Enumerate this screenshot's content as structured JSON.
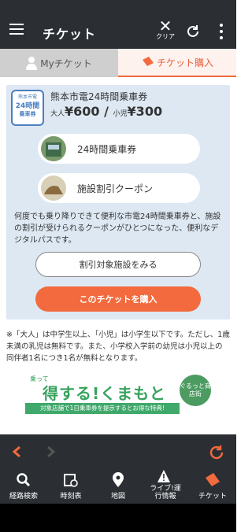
{
  "header": {
    "title": "チケット",
    "clear_label": "クリア"
  },
  "tabs": {
    "my": "Myチケット",
    "buy": "チケット購入"
  },
  "ticket": {
    "icon_top": "熊本市電",
    "icon_mid": "24時間",
    "icon_bottom": "乗車券",
    "name": "熊本市電24時間乗車券",
    "adult_label": "大人",
    "adult_price": "¥600",
    "separator": " / ",
    "child_label": "小児",
    "child_price": "¥300",
    "items": [
      {
        "label": "24時間乗車券"
      },
      {
        "label": "施設割引クーポン"
      }
    ],
    "description": "何度でも乗り降りできて便利な市電24時間乗車券と、施設の割引が受けられるクーポンがひとつになった、便利なデジタルパスです。",
    "facilities_button": "割引対象施設をみる",
    "buy_button": "このチケットを購入"
  },
  "note": "※「大人」は中学生以上、「小児」は小学生以下です。ただし、1歳未満の乳児は無料です。また、小学校入学前の幼児は小児以上の同伴者1名につき1名が無料となります。",
  "banner": {
    "small": "乗って",
    "headline": "得する!くまもと",
    "circle": "ぐるっと商店街",
    "strip": "対象店舗で1日乗車券を提示するとお得な特典!"
  },
  "bottom_nav": [
    {
      "label": "経路検索",
      "icon": "search-icon"
    },
    {
      "label": "時刻表",
      "icon": "timetable-icon"
    },
    {
      "label": "地図",
      "icon": "map-pin-icon"
    },
    {
      "label": "ライブ!運行情報",
      "icon": "live-info-icon"
    },
    {
      "label": "チケット",
      "icon": "ticket-icon"
    }
  ],
  "colors": {
    "accent": "#f26a3d",
    "header": "#2b2f34",
    "card_bg": "#dde8f3"
  }
}
